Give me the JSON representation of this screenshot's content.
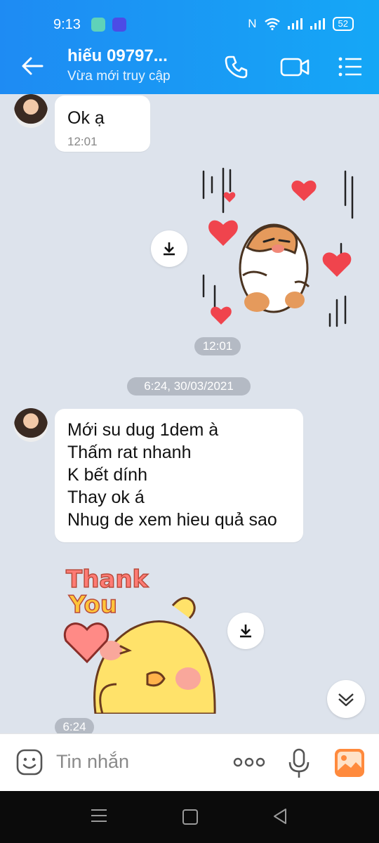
{
  "status_bar": {
    "time": "9:13",
    "battery": "52",
    "icons": [
      "app-icon-green",
      "app-icon-blue",
      "nfc-icon",
      "wifi-icon",
      "signal-icon",
      "signal-icon",
      "battery-icon"
    ]
  },
  "header": {
    "title": "hiếu  09797...",
    "subtitle": "Vừa mới truy cập",
    "icons": [
      "back-arrow-icon",
      "phone-icon",
      "video-call-icon",
      "menu-list-icon"
    ]
  },
  "messages": [
    {
      "type": "text",
      "sender": "other",
      "text": "Ok ạ",
      "time": "12:01"
    },
    {
      "type": "sticker",
      "sender": "self",
      "sticker": "hamster-hearts",
      "time": "12:01"
    },
    {
      "type": "date_separator",
      "text": "6:24, 30/03/2021"
    },
    {
      "type": "text",
      "sender": "other",
      "text": "Mới su dug 1dem à\nThấm rat nhanh\nK bết dính\nThay ok á\nNhug de xem hieu quả sao"
    },
    {
      "type": "sticker",
      "sender": "other",
      "sticker": "thank-you-chick",
      "sticker_text": [
        "Thank",
        "You"
      ],
      "time": "6:24"
    }
  ],
  "composer": {
    "placeholder": "Tin nhắn",
    "icons": [
      "sticker-icon",
      "more-icon",
      "microphone-icon",
      "image-icon"
    ]
  },
  "colors": {
    "header_blue": "#1e8bf3",
    "chat_bg": "#dde3ec",
    "pill_bg": "#b4bac4",
    "accent_orange": "#ff8a3d"
  }
}
